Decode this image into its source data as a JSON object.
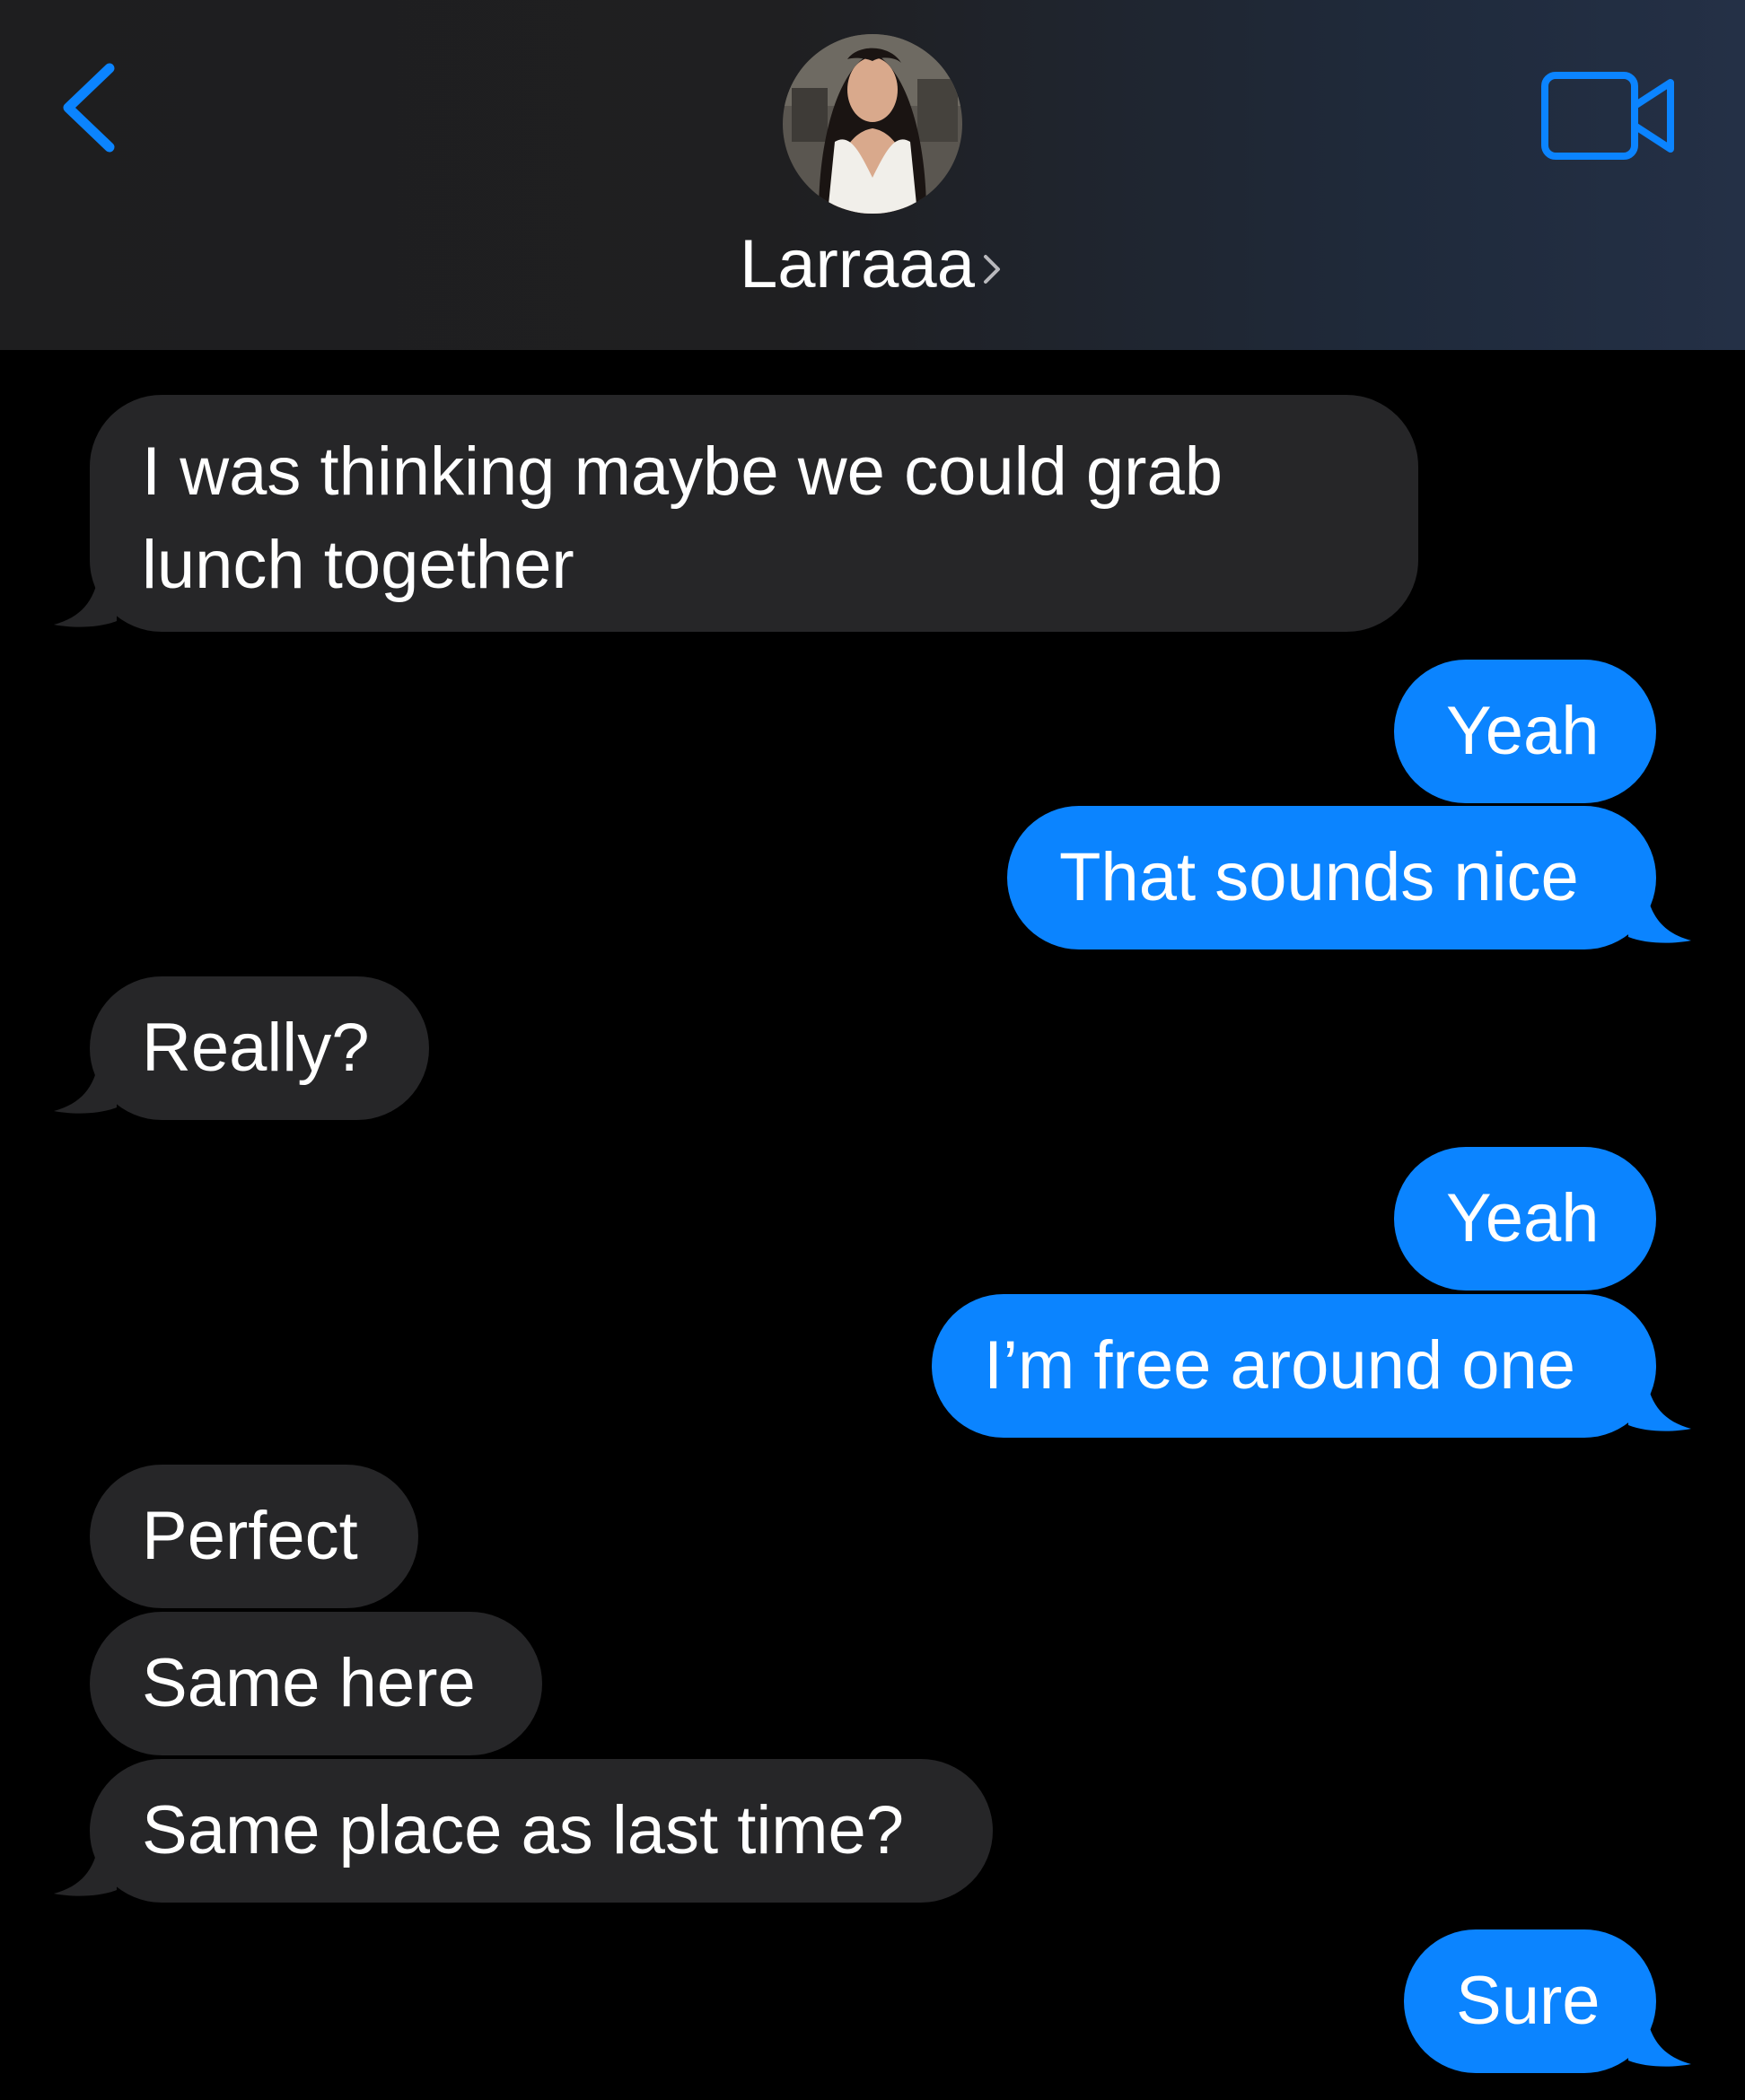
{
  "header": {
    "back_icon": "chevron-left-icon",
    "contact_name": "Larraaa",
    "video_icon": "video-camera-icon",
    "accent_color": "#0b84ff"
  },
  "messages": [
    {
      "direction": "incoming",
      "text": "I was thinking maybe we could grab lunch together"
    },
    {
      "direction": "outgoing",
      "text": "Yeah"
    },
    {
      "direction": "outgoing",
      "text": "That sounds nice"
    },
    {
      "direction": "incoming",
      "text": "Really?"
    },
    {
      "direction": "outgoing",
      "text": "Yeah"
    },
    {
      "direction": "outgoing",
      "text": "I’m free around one"
    },
    {
      "direction": "incoming",
      "text": "Perfect"
    },
    {
      "direction": "incoming",
      "text": "Same here"
    },
    {
      "direction": "incoming",
      "text": "Same place as last time?"
    },
    {
      "direction": "outgoing",
      "text": "Sure"
    }
  ],
  "colors": {
    "incoming_bubble": "#262628",
    "outgoing_bubble": "#0b84ff",
    "background": "#000000"
  }
}
